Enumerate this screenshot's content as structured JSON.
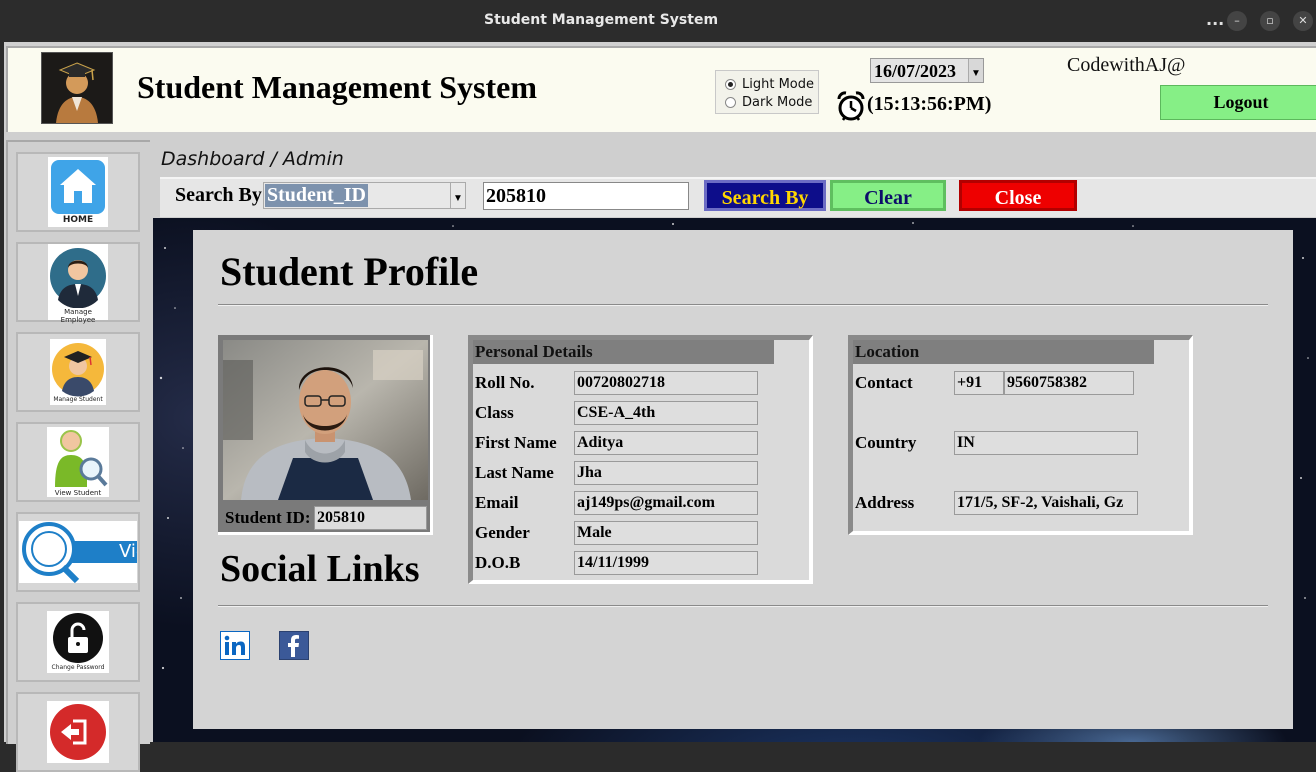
{
  "window": {
    "title": "Student Management System",
    "more_label": "...",
    "minimize_label": "–",
    "restore_label": "▫",
    "close_label": "✕"
  },
  "header": {
    "title": "Student Management System",
    "modes": [
      "Light Mode",
      "Dark Mode"
    ],
    "selected_mode": "Light Mode",
    "date": "16/07/2023",
    "time": "(15:13:56:PM)",
    "user": "CodewithAJ@",
    "logout_label": "Logout"
  },
  "sidebar": {
    "items": [
      {
        "label": "HOME",
        "icon": "home-icon"
      },
      {
        "label": "Manage Employee",
        "icon": "employee-icon"
      },
      {
        "label": "Manage Student",
        "icon": "student-icon"
      },
      {
        "label": "View Student",
        "icon": "view-student-icon"
      },
      {
        "label": "Viev",
        "icon": "magnifier-icon"
      },
      {
        "label": "Change Password",
        "icon": "lock-icon"
      },
      {
        "label": "",
        "icon": "exit-icon"
      }
    ]
  },
  "breadcrumb": "Dashboard / Admin",
  "search": {
    "label": "Search By",
    "field": "Student_ID",
    "value": "205810",
    "search_button": "Search By",
    "clear_button": "Clear",
    "close_button": "Close"
  },
  "profile": {
    "title": "Student Profile",
    "student_id_label": "Student ID:",
    "student_id": "205810",
    "social_title": "Social Links",
    "social": [
      "linkedin-icon",
      "facebook-icon"
    ]
  },
  "personal": {
    "title": "Personal Details",
    "fields": [
      {
        "label": "Roll No.",
        "value": "00720802718"
      },
      {
        "label": "Class",
        "value": "CSE-A_4th"
      },
      {
        "label": "First Name",
        "value": "Aditya"
      },
      {
        "label": "Last Name",
        "value": "Jha"
      },
      {
        "label": "Email",
        "value": "aj149ps@gmail.com"
      },
      {
        "label": "Gender",
        "value": "Male"
      },
      {
        "label": "D.O.B",
        "value": "14/11/1999"
      }
    ]
  },
  "location": {
    "title": "Location",
    "contact_label": "Contact",
    "country_code": "+91",
    "phone": "9560758382",
    "country_label": "Country",
    "country": "IN",
    "address_label": "Address",
    "address": "171/5, SF-2, Vaishali, Gz"
  },
  "colors": {
    "search_button": "#0d0d8a",
    "clear_button": "#86ef86",
    "close_button": "#ee0000",
    "logout_button": "#86ef86"
  }
}
